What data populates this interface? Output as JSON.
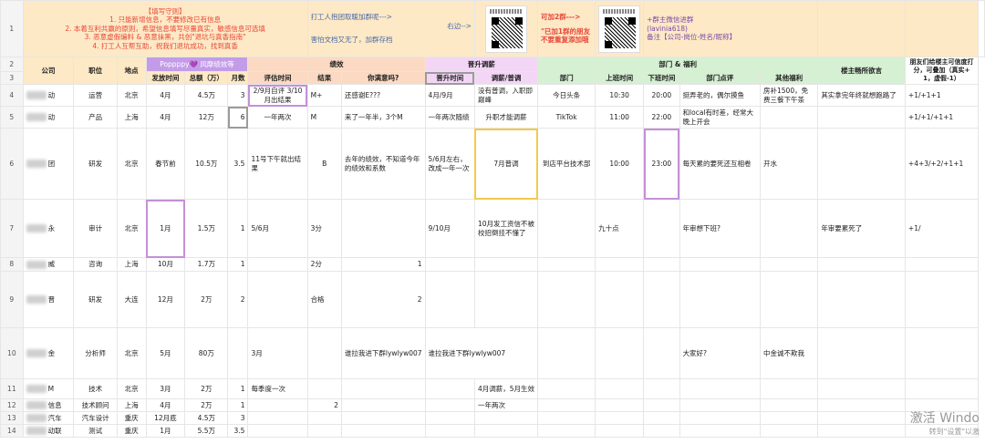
{
  "rows": [
    "1",
    "2",
    "3",
    "4",
    "5",
    "6",
    "7",
    "8",
    "9",
    "10",
    "11",
    "12",
    "13",
    "14"
  ],
  "intro": {
    "rules_title": "【填写守则】",
    "rules": [
      "1. 只能新增信息，不要修改已有信息",
      "2. 本着互利共赢的原则，希望信息填写尽量真实，敏感信息可选填",
      "3. 恶意虚假编料 & 恶意抹黑，共创\"退坑与真香指南\"",
      "4. 打工人互帮互助，祝我们退坑成功，找到真香"
    ],
    "join_text": "打工人抱团取暖加群呢--->",
    "right_text": "右边-->",
    "afraid_text": "害怕文档又无了，加群存档",
    "add2_text": "可加2群--->",
    "joined_text": "\"已加1群的朋友不要重复添加哦",
    "wechat_text": "+群主微信进群",
    "wechat_id": "(lavinia618)",
    "note_text": "备注【公司-岗位-姓名/昵称】"
  },
  "groups": {
    "performance": "绩效",
    "promotion": "晋升调薪",
    "dept_welfare": "部门 & 福利",
    "owner_words": "楼主畅所欲言",
    "credibility": "朋友们给楼主可信度打分，可叠加（真实+1，虚假-1）",
    "popp": "Poppppy💜 风靡绩效等"
  },
  "headers": {
    "company": "公司",
    "position": "职位",
    "location": "地点",
    "pay_time": "发放时间",
    "total": "总额（万）",
    "months": "月数",
    "eval_time": "评估时间",
    "result": "结果",
    "satisfied": "你满意吗?",
    "promo_time": "晋升时间",
    "raise": "调薪/普调",
    "dept": "部门",
    "work_start": "上班时间",
    "work_end": "下班时间",
    "dept_review": "部门点评",
    "other_welfare": "其他福利"
  },
  "table_rows": [
    {
      "company": "动",
      "position": "运营",
      "location": "北京",
      "pay_time": "4月",
      "total": "4.5万",
      "months": "3",
      "eval_time": "2/9月自评 3/10月出结果",
      "result": "M+",
      "satisfied": "还感谢E???",
      "promo_time": "4月/9月",
      "raise": "没有普调，入职即巅峰",
      "dept": "今日头条",
      "work_start": "10:30",
      "work_end": "20:00",
      "dept_review": "挺弄老的，偶尔摸鱼",
      "other_welfare": "房补1500，免费三餐下午茶",
      "owner_words": "其实拿完年终就想跑路了",
      "score": "+1/+1+1"
    },
    {
      "company": "动",
      "position": "产品",
      "location": "上海",
      "pay_time": "4月",
      "total": "12万",
      "months": "6",
      "eval_time": "一年两次",
      "result": "M",
      "satisfied": "来了一年半，3个M",
      "promo_time": "一年两次随绩",
      "raise": "升职才能调薪",
      "dept": "TikTok",
      "work_start": "11:00",
      "work_end": "22:00",
      "dept_review": "和local有时差，经常大晚上开会",
      "other_welfare": "",
      "owner_words": "",
      "score": "+1/+1/+1+1"
    },
    {
      "company": "团",
      "position": "研发",
      "location": "北京",
      "pay_time": "春节前",
      "total": "10.5万",
      "months": "3.5",
      "eval_time": "11号下午就出结果",
      "result": "B",
      "satisfied": "去年的绩效，不知道今年的绩效和系数",
      "promo_time": "5/6月左右，改成一年一次",
      "raise": "7月普调",
      "dept": "到店平台技术部",
      "work_start": "10:00",
      "work_end": "23:00",
      "dept_review": "每天累的要死还互相卷",
      "other_welfare": "开水",
      "owner_words": "",
      "score": "+4+3/+2/+1+1"
    },
    {
      "company": "永",
      "position": "审计",
      "location": "北京",
      "pay_time": "1月",
      "total": "1.5万",
      "months": "1",
      "eval_time": "5/6月",
      "result": "3分",
      "satisfied": "",
      "promo_time": "9/10月",
      "raise": "10月发工资信不被校招倒挂不懂了",
      "dept": "",
      "work_start": "九十点",
      "work_end": "",
      "dept_review": "年审想下班?",
      "other_welfare": "",
      "owner_words": "年审要累死了",
      "score": "+1/"
    },
    {
      "company": "威",
      "position": "咨询",
      "location": "上海",
      "pay_time": "10月",
      "total": "1.7万",
      "months": "1",
      "eval_time": "",
      "result": "2分",
      "satisfied": "1",
      "promo_time": "",
      "raise": "",
      "dept": "",
      "work_start": "",
      "work_end": "",
      "dept_review": "",
      "other_welfare": "",
      "owner_words": "",
      "score": ""
    },
    {
      "company": "晋",
      "position": "研发",
      "location": "大连",
      "pay_time": "12月",
      "total": "2万",
      "months": "2",
      "eval_time": "",
      "result": "合格",
      "satisfied": "2",
      "promo_time": "",
      "raise": "",
      "dept": "",
      "work_start": "",
      "work_end": "",
      "dept_review": "",
      "other_welfare": "",
      "owner_words": "",
      "score": ""
    },
    {
      "company": "金",
      "position": "分析师",
      "location": "北京",
      "pay_time": "5月",
      "total": "80万",
      "months": "",
      "eval_time": "3月",
      "result": "",
      "satisfied": "谁拉我进下群lywlyw007",
      "promo_time": "谁拉我进下群lywlyw007",
      "raise": "",
      "dept": "",
      "work_start": "",
      "work_end": "",
      "dept_review": "大家好?",
      "other_welfare": "中金诚不欺我",
      "owner_words": "",
      "score": ""
    },
    {
      "company": "M",
      "position": "技术",
      "location": "北京",
      "pay_time": "3月",
      "total": "2万",
      "months": "1",
      "eval_time": "每季度一次",
      "result": "",
      "satisfied": "",
      "promo_time": "",
      "raise": "4月调薪，5月生效",
      "dept": "",
      "work_start": "",
      "work_end": "",
      "dept_review": "",
      "other_welfare": "",
      "owner_words": "",
      "score": ""
    },
    {
      "company": "信息",
      "position": "技术顾问",
      "location": "上海",
      "pay_time": "4月",
      "total": "2万",
      "months": "1",
      "eval_time": "",
      "result": "2",
      "satisfied": "",
      "promo_time": "",
      "raise": "一年两次",
      "dept": "",
      "work_start": "",
      "work_end": "",
      "dept_review": "",
      "other_welfare": "",
      "owner_words": "",
      "score": ""
    },
    {
      "company": "汽车",
      "position": "汽车设计",
      "location": "重庆",
      "pay_time": "12月底",
      "total": "4.5万",
      "months": "3",
      "eval_time": "",
      "result": "",
      "satisfied": "",
      "promo_time": "",
      "raise": "",
      "dept": "",
      "work_start": "",
      "work_end": "",
      "dept_review": "",
      "other_welfare": "",
      "owner_words": "",
      "score": ""
    },
    {
      "company": "动联",
      "position": "测试",
      "location": "重庆",
      "pay_time": "1月",
      "total": "5.5万",
      "months": "3.5",
      "eval_time": "",
      "result": "",
      "satisfied": "",
      "promo_time": "",
      "raise": "",
      "dept": "",
      "work_start": "",
      "work_end": "",
      "dept_review": "",
      "other_welfare": "",
      "owner_words": "",
      "score": ""
    }
  ],
  "watermark": {
    "title": "激活 Windo",
    "sub": "转到\"设置\"以激"
  }
}
